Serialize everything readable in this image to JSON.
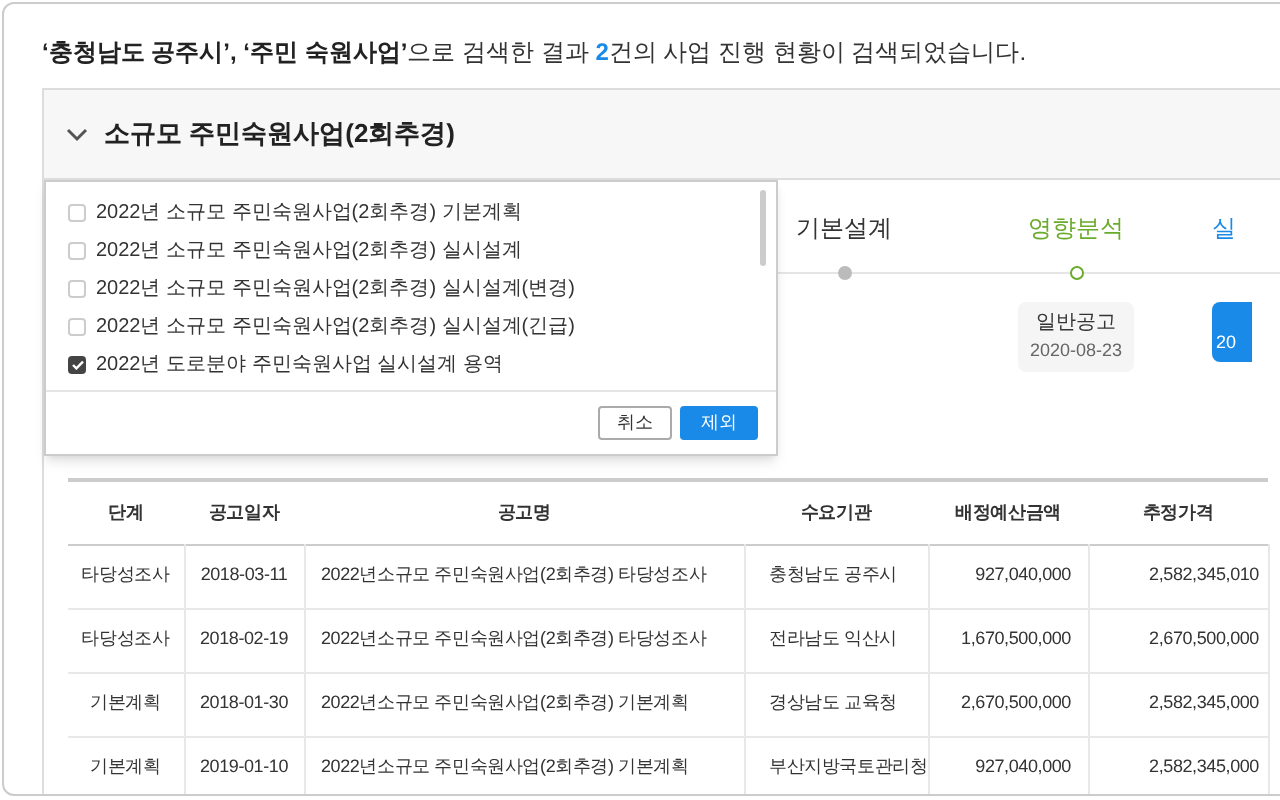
{
  "summary": [
    {
      "kind": "bold",
      "text": "‘충청남도 공주시’, ‘주민 숙원사업’"
    },
    {
      "kind": "plain",
      "text": "으로 검색한 결과 "
    },
    {
      "kind": "count",
      "text": "2"
    },
    {
      "kind": "plain",
      "text": "건의 사업 진행 현황이 검색되었습니다."
    }
  ],
  "panel": {
    "title": "소규모 주민숙원사업(2회추경)",
    "expanded": true
  },
  "timeline": [
    {
      "label": "기본설계",
      "kind": "done"
    },
    {
      "label": "영향분석",
      "kind": "current",
      "card": {
        "kind": "plain",
        "title": "일반공고",
        "date": "2020-08-23"
      }
    },
    {
      "label": "실",
      "kind": "active",
      "card": {
        "kind": "highlight",
        "date": "20"
      }
    }
  ],
  "popup": {
    "items": [
      {
        "label": "2022년 소규모 주민숙원사업(2회추경) 기본계획",
        "checked": false
      },
      {
        "label": "2022년 소규모 주민숙원사업(2회추경) 실시설계",
        "checked": false
      },
      {
        "label": "2022년 소규모 주민숙원사업(2회추경) 실시설계(변경)",
        "checked": false
      },
      {
        "label": "2022년 소규모 주민숙원사업(2회추경) 실시설계(긴급)",
        "checked": false
      },
      {
        "label": "2022년 도로분야 주민숙원사업 실시설계 용역",
        "checked": true
      }
    ],
    "buttons": [
      {
        "label": "취소",
        "kind": "secondary"
      },
      {
        "label": "제외",
        "kind": "primary"
      }
    ]
  },
  "table": {
    "columns": [
      "단계",
      "공고일자",
      "공고명",
      "수요기관",
      "배정예산금액",
      "추정가격"
    ],
    "rows": [
      [
        "타당성조사",
        "2018-03-11",
        "2022년소규모 주민숙원사업(2회추경) 타당성조사",
        "충청남도 공주시",
        "927,040,000",
        "2,582,345,010"
      ],
      [
        "타당성조사",
        "2018-02-19",
        "2022년소규모 주민숙원사업(2회추경) 타당성조사",
        "전라남도 익산시",
        "1,670,500,000",
        "2,670,500,000"
      ],
      [
        "기본계획",
        "2018-01-30",
        "2022년소규모 주민숙원사업(2회추경) 기본계획",
        "경상남도 교육청",
        "2,670,500,000",
        "2,582,345,000"
      ],
      [
        "기본계획",
        "2019-01-10",
        "2022년소규모 주민숙원사업(2회추경) 기본계획",
        "부산지방국토관리청",
        "927,040,000",
        "2,582,345,000"
      ]
    ]
  }
}
